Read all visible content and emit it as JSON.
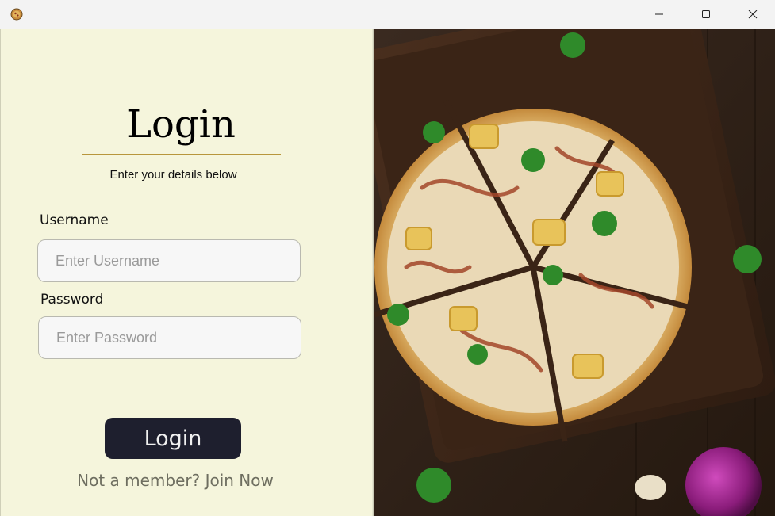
{
  "window": {
    "app_icon": "pizza-app-icon"
  },
  "form": {
    "title": "Login",
    "subtitle": "Enter your details below",
    "username_label": "Username",
    "username_placeholder": "Enter Username",
    "password_label": "Password",
    "password_placeholder": "Enter Password",
    "login_button": "Login",
    "join_link": "Not a member? Join Now"
  },
  "colors": {
    "panel_bg": "#f5f5dc",
    "title_rule": "#b8963c",
    "button_bg": "#1e1f2e",
    "link": "#6e6e60"
  },
  "hero_image": {
    "subject": "pizza-on-wooden-board"
  }
}
